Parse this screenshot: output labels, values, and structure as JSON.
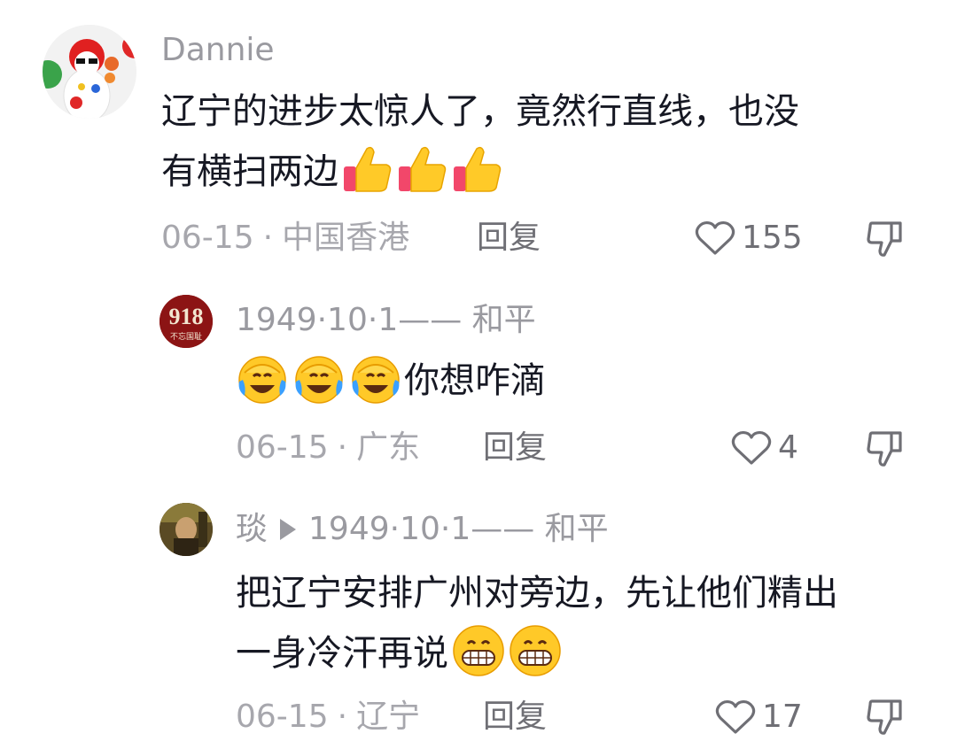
{
  "comments": [
    {
      "author": "Dannie",
      "text1": "辽宁的进步太惊人了，竟然行直线，也没",
      "text2": "有横扫两边",
      "emoji_count": 3,
      "emoji": "thumbs-up",
      "date": "06-15",
      "location": "中国香港",
      "reply_label": "回复",
      "likes": "155"
    },
    {
      "author": "1949·10·1—— 和平",
      "avatar_text": "918",
      "avatar_sub": "不忘国耻",
      "text": "你想咋滴",
      "emoji_count": 3,
      "emoji": "laughing-crying",
      "date": "06-15",
      "location": "广东",
      "reply_label": "回复",
      "likes": "4"
    },
    {
      "author": "琰",
      "reply_to": "1949·10·1—— 和平",
      "text1": "把辽宁安排广州对旁边，先让他们精出",
      "text2": "一身冷汗再说",
      "emoji_count": 2,
      "emoji": "grin",
      "date": "06-15",
      "location": "辽宁",
      "reply_label": "回复",
      "likes": "17"
    }
  ],
  "separator": "·",
  "colors": {
    "text": "#161823",
    "meta": "#a7a7ad",
    "action": "#6f6f75"
  }
}
